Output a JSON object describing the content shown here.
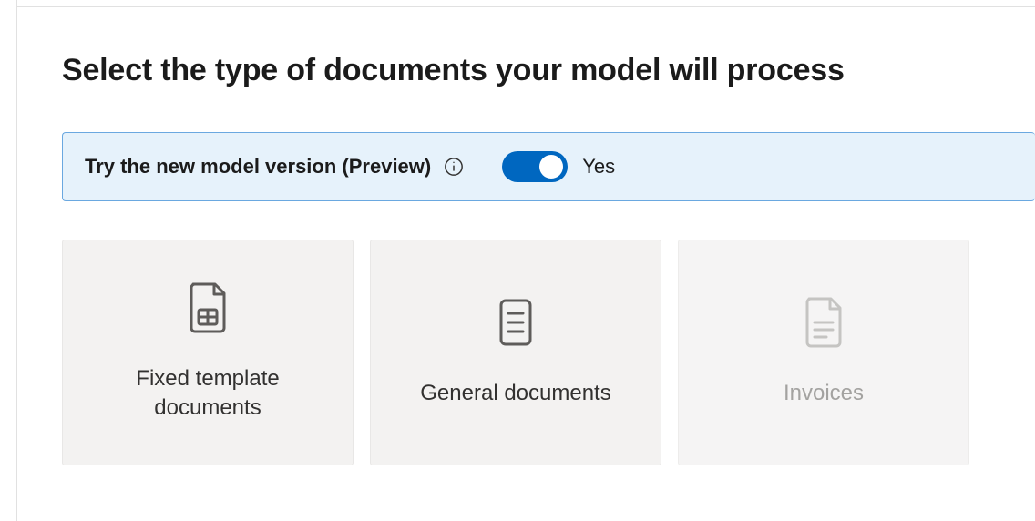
{
  "page": {
    "title": "Select the type of documents your model will process"
  },
  "preview_banner": {
    "label": "Try the new model version (Preview)",
    "toggle_state": "Yes"
  },
  "cards": [
    {
      "label": "Fixed template documents",
      "icon": "fixed-template-document-icon",
      "enabled": true
    },
    {
      "label": "General documents",
      "icon": "general-document-icon",
      "enabled": true
    },
    {
      "label": "Invoices",
      "icon": "invoice-document-icon",
      "enabled": false
    }
  ]
}
